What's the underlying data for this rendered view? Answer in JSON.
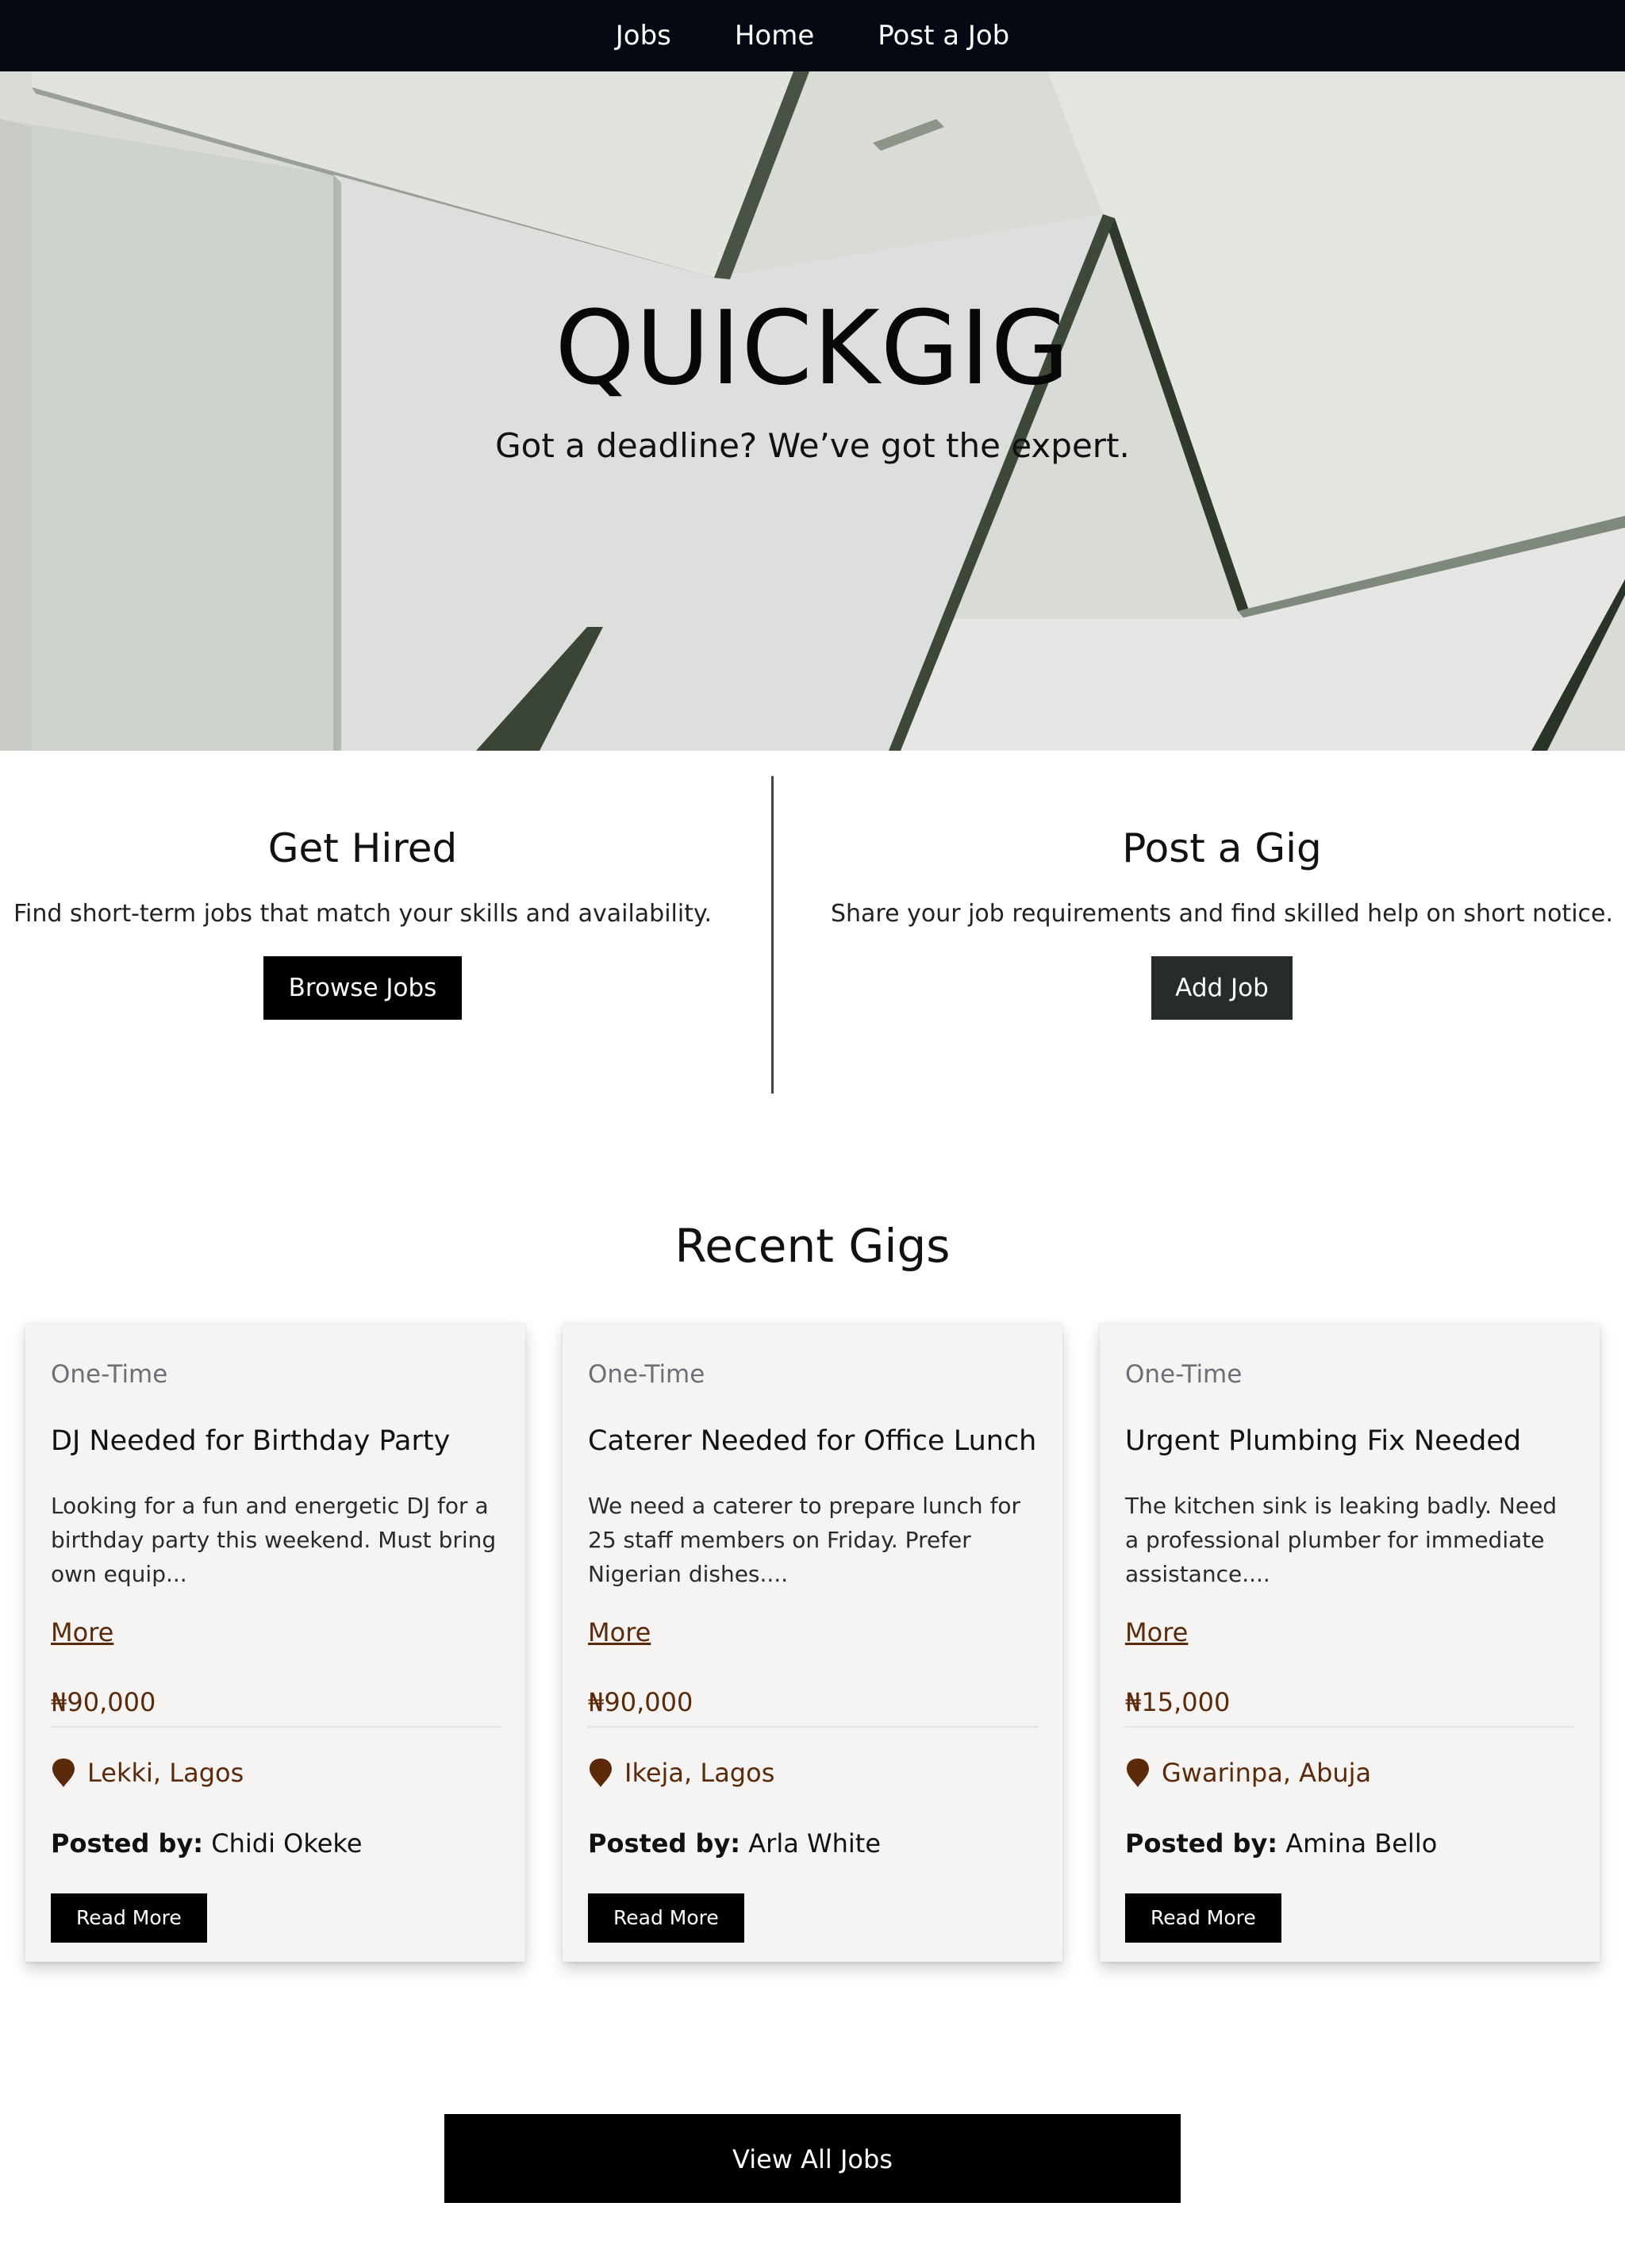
{
  "nav": {
    "items": [
      {
        "label": "Jobs"
      },
      {
        "label": "Home"
      },
      {
        "label": "Post a Job"
      }
    ]
  },
  "hero": {
    "title": "QUICKGIG",
    "tagline": "Got a deadline? We’ve got the expert."
  },
  "get_hired": {
    "heading": "Get Hired",
    "text": "Find short-term jobs that match your skills and availability.",
    "button": "Browse Jobs"
  },
  "post_gig": {
    "heading": "Post a Gig",
    "text": "Share your job requirements and find skilled help on short notice.",
    "button": "Add Job"
  },
  "recent": {
    "title": "Recent Gigs",
    "cards": [
      {
        "type": "One-Time",
        "title": "DJ Needed for Birthday Party",
        "desc": "Looking for a fun and energetic DJ for a birthday party this weekend. Must bring own equip...",
        "more": "More",
        "price": "₦90,000",
        "location": "Lekki, Lagos",
        "posted_label": "Posted by:",
        "posted_by": "Chidi Okeke",
        "read_more": "Read More"
      },
      {
        "type": "One-Time",
        "title": "Caterer Needed for Office Lunch",
        "desc": "We need a caterer to prepare lunch for 25 staff members on Friday. Prefer Nigerian dishes....",
        "more": "More",
        "price": "₦90,000",
        "location": "Ikeja, Lagos",
        "posted_label": "Posted by:",
        "posted_by": "Arla White",
        "read_more": "Read More"
      },
      {
        "type": "One-Time",
        "title": "Urgent Plumbing Fix Needed",
        "desc": "The kitchen sink is leaking badly. Need a professional plumber for immediate assistance....",
        "more": "More",
        "price": "₦15,000",
        "location": "Gwarinpa, Abuja",
        "posted_label": "Posted by:",
        "posted_by": "Amina Bello",
        "read_more": "Read More"
      }
    ],
    "view_all": "View All Jobs"
  },
  "colors": {
    "nav_bg": "#040914",
    "accent_brown": "#5a2a0a",
    "card_bg": "#f5f4f3",
    "button_black": "#000000",
    "button_dark": "#262b2c"
  }
}
